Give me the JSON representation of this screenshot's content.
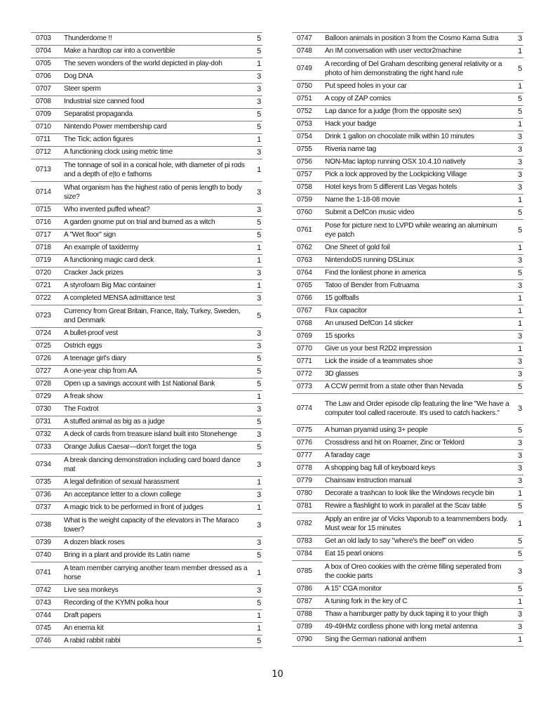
{
  "page": {
    "page_number": "10",
    "left_column": [
      {
        "id": "0703",
        "desc": "Thunderdome !!",
        "pts": "5",
        "lines": 1
      },
      {
        "id": "0704",
        "desc": "Make a hardtop car into a convertible",
        "pts": "5",
        "lines": 1
      },
      {
        "id": "0705",
        "desc": "The seven wonders of the world depicted in play-doh",
        "pts": "1",
        "lines": 1
      },
      {
        "id": "0706",
        "desc": "Dog DNA",
        "pts": "3",
        "lines": 1
      },
      {
        "id": "0707",
        "desc": "Steer sperm",
        "pts": "3",
        "lines": 1
      },
      {
        "id": "0708",
        "desc": "Industrial size canned food",
        "pts": "3",
        "lines": 1
      },
      {
        "id": "0709",
        "desc": "Separatist propaganda",
        "pts": "5",
        "lines": 1
      },
      {
        "id": "0710",
        "desc": "Nintendo Power membership card",
        "pts": "5",
        "lines": 1
      },
      {
        "id": "0711",
        "desc": "The Tick; action figures",
        "pts": "1",
        "lines": 1
      },
      {
        "id": "0712",
        "desc": "A functioning clock using metric time",
        "pts": "3",
        "lines": 1
      },
      {
        "id": "0713",
        "desc": "The tonnage of soil in a conical hole, with diameter of pi rods and a depth of e|to e fathoms",
        "pts": "1",
        "lines": 2
      },
      {
        "id": "0714",
        "desc": "What organism has the highest ratio of penis length to body size?",
        "pts": "3",
        "lines": 2
      },
      {
        "id": "0715",
        "desc": "Who invented puffed wheat?",
        "pts": "3",
        "lines": 1
      },
      {
        "id": "0716",
        "desc": "A garden gnome put on trial and burned as a witch",
        "pts": "5",
        "lines": 1
      },
      {
        "id": "0717",
        "desc": "A \"Wet floor\" sign",
        "pts": "5",
        "lines": 1
      },
      {
        "id": "0718",
        "desc": "An example of taxidermy",
        "pts": "1",
        "lines": 1
      },
      {
        "id": "0719",
        "desc": "A functioning magic card deck",
        "pts": "1",
        "lines": 1
      },
      {
        "id": "0720",
        "desc": "Cracker Jack prizes",
        "pts": "3",
        "lines": 1
      },
      {
        "id": "0721",
        "desc": "A styrofoam Big Mac container",
        "pts": "1",
        "lines": 1
      },
      {
        "id": "0722",
        "desc": "A completed MENSA admittance test",
        "pts": "3",
        "lines": 1
      },
      {
        "id": "0723",
        "desc": "Currency from Great Britain, France, Italy, Turkey, Sweden, and Denmark",
        "pts": "5",
        "lines": 2
      },
      {
        "id": "0724",
        "desc": "A bullet-proof vest",
        "pts": "3",
        "lines": 1
      },
      {
        "id": "0725",
        "desc": "Ostrich eggs",
        "pts": "3",
        "lines": 1
      },
      {
        "id": "0726",
        "desc": "A teenage girl's diary",
        "pts": "5",
        "lines": 1
      },
      {
        "id": "0727",
        "desc": "A one-year chip from AA",
        "pts": "5",
        "lines": 1
      },
      {
        "id": "0728",
        "desc": "Open up a savings account with 1st National Bank",
        "pts": "5",
        "lines": 1
      },
      {
        "id": "0729",
        "desc": "A freak show",
        "pts": "1",
        "lines": 1
      },
      {
        "id": "0730",
        "desc": "The Foxtrot",
        "pts": "3",
        "lines": 1
      },
      {
        "id": "0731",
        "desc": "A stuffed animal as big as a judge",
        "pts": "5",
        "lines": 1
      },
      {
        "id": "0732",
        "desc": "A deck of cards from treasure island built into Stonehenge",
        "pts": "3",
        "lines": 1
      },
      {
        "id": "0733",
        "desc": "Orange Julius Caesar—don't forget the toga",
        "pts": "5",
        "lines": 1
      },
      {
        "id": "0734",
        "desc": "A break dancing demonstration including card board dance mat",
        "pts": "3",
        "lines": 2
      },
      {
        "id": "0735",
        "desc": "A legal definition of sexual harassment",
        "pts": "1",
        "lines": 1
      },
      {
        "id": "0736",
        "desc": "An acceptance letter to a clown college",
        "pts": "3",
        "lines": 1
      },
      {
        "id": "0737",
        "desc": "A magic trick to be performed in front of judges",
        "pts": "1",
        "lines": 1
      },
      {
        "id": "0738",
        "desc": "What is the weight capacity of the elevators in The Maraco tower?",
        "pts": "3",
        "lines": 2
      },
      {
        "id": "0739",
        "desc": "A dozen black roses",
        "pts": "3",
        "lines": 1
      },
      {
        "id": "0740",
        "desc": "Bring in a plant and provide its Latin name",
        "pts": "5",
        "lines": 1
      },
      {
        "id": "0741",
        "desc": "A team member carrying another team member dressed as a horse",
        "pts": "1",
        "lines": 2
      },
      {
        "id": "0742",
        "desc": "Live sea monkeys",
        "pts": "3",
        "lines": 1
      },
      {
        "id": "0743",
        "desc": "Recording of the KYMN polka hour",
        "pts": "5",
        "lines": 1
      },
      {
        "id": "0744",
        "desc": "Draft papers",
        "pts": "1",
        "lines": 1
      },
      {
        "id": "0745",
        "desc": "An enema kit",
        "pts": "1",
        "lines": 1
      },
      {
        "id": "0746",
        "desc": "A rabid rabbit rabbi",
        "pts": "5",
        "lines": 1
      }
    ],
    "right_column": [
      {
        "id": "0747",
        "desc": "Balloon animals in position 3 from the Cosmo Kama Sutra",
        "pts": "3",
        "lines": 1
      },
      {
        "id": "0748",
        "desc": "An IM conversation with user vector2machine",
        "pts": "1",
        "lines": 1
      },
      {
        "id": "0749",
        "desc": "A recording of Del Graham describing general relativity or a photo of him demonstrating the right hand rule",
        "pts": "5",
        "lines": 2
      },
      {
        "id": "0750",
        "desc": "Put speed holes in your car",
        "pts": "1",
        "lines": 1
      },
      {
        "id": "0751",
        "desc": "A copy of ZAP comics",
        "pts": "5",
        "lines": 1
      },
      {
        "id": "0752",
        "desc": "Lap dance for a judge (from the opposite sex)",
        "pts": "5",
        "lines": 1
      },
      {
        "id": "0753",
        "desc": "Hack your badge",
        "pts": "1",
        "lines": 1
      },
      {
        "id": "0754",
        "desc": "Drink 1 gallon on chocolate milk within 10 minutes",
        "pts": "3",
        "lines": 1
      },
      {
        "id": "0755",
        "desc": "Riveria name tag",
        "pts": "3",
        "lines": 1
      },
      {
        "id": "0756",
        "desc": "NON-Mac laptop running OSX 10.4.10 natively",
        "pts": "3",
        "lines": 1
      },
      {
        "id": "0757",
        "desc": "Pick a lock approved by the Lockpicking Village",
        "pts": "3",
        "lines": 1
      },
      {
        "id": "0758",
        "desc": "Hotel keys from 5 different Las Vegas hotels",
        "pts": "3",
        "lines": 1
      },
      {
        "id": "0759",
        "desc": "Name the 1-18-08 movie",
        "pts": "1",
        "lines": 1
      },
      {
        "id": "0760",
        "desc": "Submit a DefCon music video",
        "pts": "5",
        "lines": 1
      },
      {
        "id": "0761",
        "desc": "Pose for picture next to LVPD while wearing an aluminum eye patch",
        "pts": "5",
        "lines": 2
      },
      {
        "id": "0762",
        "desc": "One Sheet of gold foil",
        "pts": "1",
        "lines": 1
      },
      {
        "id": "0763",
        "desc": "NintendoDS running DSLinux",
        "pts": "3",
        "lines": 1
      },
      {
        "id": "0764",
        "desc": "Find the lonliest phone in america",
        "pts": "5",
        "lines": 1
      },
      {
        "id": "0765",
        "desc": "Tatoo of Bender from Futruama",
        "pts": "3",
        "lines": 1
      },
      {
        "id": "0766",
        "desc": "15 golfballs",
        "pts": "1",
        "lines": 1
      },
      {
        "id": "0767",
        "desc": "Flux capacitor",
        "pts": "1",
        "lines": 1
      },
      {
        "id": "0768",
        "desc": "An unused DefCon 14 sticker",
        "pts": "1",
        "lines": 1
      },
      {
        "id": "0769",
        "desc": "15 sporks",
        "pts": "3",
        "lines": 1
      },
      {
        "id": "0770",
        "desc": "Give us your best R2D2 impression",
        "pts": "1",
        "lines": 1
      },
      {
        "id": "0771",
        "desc": "Lick the inside of a teammates shoe",
        "pts": "3",
        "lines": 1
      },
      {
        "id": "0772",
        "desc": "3D glasses",
        "pts": "3",
        "lines": 1
      },
      {
        "id": "0773",
        "desc": "A CCW permit from a state other than Nevada",
        "pts": "5",
        "lines": 1
      },
      {
        "id": "0774",
        "desc": "The Law and Order episode clip featuring the line \"We have a computer tool called raceroute. It's used to catch hackers.\"",
        "pts": "3",
        "lines": 3
      },
      {
        "id": "0775",
        "desc": "A human pryamid using 3+ people",
        "pts": "5",
        "lines": 1
      },
      {
        "id": "0776",
        "desc": "Crossdress and hit on Roamer, Zinc or Teklord",
        "pts": "3",
        "lines": 1
      },
      {
        "id": "0777",
        "desc": "A faraday cage",
        "pts": "3",
        "lines": 1
      },
      {
        "id": "0778",
        "desc": "A shopping bag full of keyboard keys",
        "pts": "3",
        "lines": 1
      },
      {
        "id": "0779",
        "desc": "Chainsaw instruction manual",
        "pts": "3",
        "lines": 1
      },
      {
        "id": "0780",
        "desc": "Decorate a trashcan to look like the Windows recycle bin",
        "pts": "1",
        "lines": 1
      },
      {
        "id": "0781",
        "desc": "Rewire a flashlight to work in parallel at the Scav table",
        "pts": "5",
        "lines": 1
      },
      {
        "id": "0782",
        "desc": "Apply an entire jar of Vicks Vaporub to a teammembers body. Must wear for 15 minutes",
        "pts": "1",
        "lines": 2
      },
      {
        "id": "0783",
        "desc": "Get an old lady to say \"where's the beef\" on video",
        "pts": "5",
        "lines": 1
      },
      {
        "id": "0784",
        "desc": "Eat 15 pearl onions",
        "pts": "5",
        "lines": 1
      },
      {
        "id": "0785",
        "desc": "A box of Oreo cookies with the crème filling seperated from the cookie parts",
        "pts": "3",
        "lines": 2
      },
      {
        "id": "0786",
        "desc": "A 15\" CGA monitor",
        "pts": "5",
        "lines": 1
      },
      {
        "id": "0787",
        "desc": "A tuning fork in the key of C",
        "pts": "1",
        "lines": 1
      },
      {
        "id": "0788",
        "desc": "Thaw a hamburger patty by duck taping it to your thigh",
        "pts": "3",
        "lines": 1
      },
      {
        "id": "0789",
        "desc": "49-49HMz cordless phone with long metal antenna",
        "pts": "3",
        "lines": 1
      },
      {
        "id": "0790",
        "desc": "Sing the German national anthem",
        "pts": "1",
        "lines": 1
      }
    ]
  }
}
